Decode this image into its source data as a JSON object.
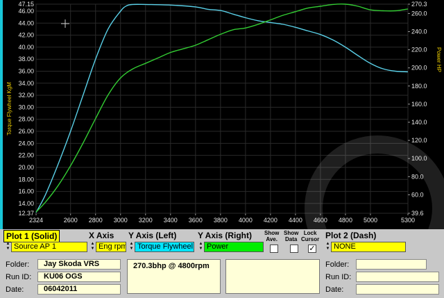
{
  "colors": {
    "torque": "#5ad0e8",
    "power": "#33cc33",
    "left_axis_text": "#e8e8e8",
    "right_axis_text": "#e8e8e8",
    "grid": "#2a2a2a",
    "field_bg": "#ffffd8",
    "highlight_yellow": "#ffff00",
    "highlight_cyan": "#00e5ff",
    "highlight_green": "#00ee00"
  },
  "chart_data": {
    "type": "line",
    "ylabel": "Torque Flywheel KgM",
    "y2label": "Power HP",
    "xlim": [
      2324,
      5300
    ],
    "ylim": [
      12.37,
      47.15
    ],
    "y2lim": [
      39.6,
      270.3
    ],
    "x_ticks": [
      "2324",
      "2600",
      "2800",
      "3000",
      "3200",
      "3400",
      "3600",
      "3800",
      "4000",
      "4200",
      "4400",
      "4600",
      "4800",
      "5000",
      "5300"
    ],
    "y_ticks": [
      "47.15",
      "46.00",
      "44.00",
      "42.00",
      "40.00",
      "38.00",
      "36.00",
      "34.00",
      "32.00",
      "30.00",
      "28.00",
      "26.00",
      "24.00",
      "22.00",
      "20.00",
      "18.00",
      "16.00",
      "14.00",
      "12.37"
    ],
    "y2_ticks": [
      "270.3",
      "260.0",
      "240.0",
      "220.0",
      "200.0",
      "180.0",
      "160.0",
      "140.0",
      "120.0",
      "100.0",
      "80.0",
      "60.0",
      "39.6"
    ],
    "series": [
      {
        "name": "Torque Flywheel",
        "axis": "left",
        "x": [
          2324,
          2400,
          2500,
          2600,
          2700,
          2800,
          2900,
          3000,
          3050,
          3100,
          3200,
          3400,
          3600,
          3700,
          3800,
          3900,
          4000,
          4100,
          4200,
          4300,
          4400,
          4500,
          4600,
          4700,
          4800,
          4900,
          5000,
          5100,
          5200,
          5300
        ],
        "y": [
          12.5,
          15.5,
          20.5,
          26.0,
          32.0,
          38.0,
          43.0,
          46.0,
          46.9,
          47.1,
          47.1,
          47.0,
          46.7,
          46.3,
          46.1,
          45.5,
          44.9,
          44.4,
          44.1,
          43.8,
          43.3,
          42.7,
          42.1,
          41.2,
          40.0,
          38.6,
          37.3,
          36.4,
          36.0,
          35.9
        ]
      },
      {
        "name": "Power",
        "axis": "right",
        "x": [
          2324,
          2400,
          2500,
          2600,
          2700,
          2800,
          2900,
          3000,
          3100,
          3200,
          3300,
          3400,
          3500,
          3600,
          3700,
          3800,
          3900,
          4000,
          4100,
          4200,
          4300,
          4400,
          4500,
          4600,
          4700,
          4800,
          4900,
          5000,
          5100,
          5200,
          5300
        ],
        "y": [
          41,
          52,
          70,
          92,
          117,
          144,
          170,
          189,
          199,
          205,
          211,
          217,
          221,
          225,
          231,
          237,
          242,
          244,
          248,
          253,
          258,
          262,
          266,
          268,
          270,
          270.3,
          268,
          264,
          263,
          263,
          265
        ]
      }
    ]
  },
  "panel": {
    "plot1": {
      "header": "Plot 1 (Solid)",
      "source": "Source AP 1"
    },
    "x_axis": {
      "header": "X Axis",
      "value": "Eng rpm"
    },
    "y_axis_left": {
      "header": "Y Axis (Left)",
      "value": "Torque Flywheel"
    },
    "y_axis_right": {
      "header": "Y Axis (Right)",
      "value": "Power"
    },
    "show_ave": {
      "label_line1": "Show",
      "label_line2": "Ave.",
      "checked": false
    },
    "show_data": {
      "label_line1": "Show",
      "label_line2": "Data",
      "checked": false
    },
    "lock_cursor": {
      "label_line1": "Lock",
      "label_line2": "Cursor",
      "checked": true,
      "check_glyph": "✓"
    },
    "plot2": {
      "header": "Plot 2 (Dash)",
      "source": "NONE"
    },
    "left_info": {
      "folder_label": "Folder:",
      "folder_value": "Jay Skoda VRS",
      "runid_label": "Run ID:",
      "runid_value": "KU06 OGS",
      "date_label": "Date:",
      "date_value": "06042011"
    },
    "result_memo": "270.3bhp @ 4800rpm",
    "right_info": {
      "folder_label": "Folder:",
      "folder_value": "",
      "runid_label": "Run ID:",
      "runid_value": "",
      "date_label": "Date:",
      "date_value": ""
    }
  }
}
